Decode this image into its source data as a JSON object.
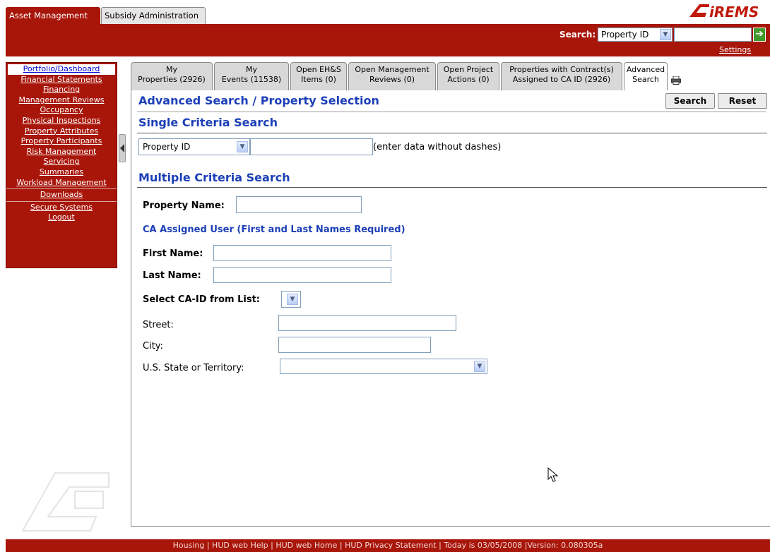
{
  "app_tabs": [
    {
      "label": "Asset Management",
      "active": true
    },
    {
      "label": "Subsidy Administration",
      "active": false
    }
  ],
  "logo": {
    "text": "iREMS"
  },
  "header": {
    "search_label": "Search:",
    "search_type": "Property ID",
    "search_value": "",
    "settings_label": "Settings"
  },
  "nav": {
    "items": [
      "Portfolio/Dashboard",
      "Financial Statements",
      "Financing",
      "Management Reviews",
      "Occupancy",
      "Physical Inspections",
      "Property Attributes",
      "Property Participants",
      "Risk Management",
      "Servicing",
      "Summaries",
      "Workload Management",
      "Downloads",
      "Secure Systems",
      "Logout"
    ]
  },
  "tabs": [
    {
      "line1": "My",
      "line2": "Properties (2926)"
    },
    {
      "line1": "My",
      "line2": "Events (11538)"
    },
    {
      "line1": "Open EH&S",
      "line2": "Items (0)"
    },
    {
      "line1": "Open Management",
      "line2": "Reviews (0)"
    },
    {
      "line1": "Open Project",
      "line2": "Actions (0)"
    },
    {
      "line1": "Properties with Contract(s)",
      "line2": "Assigned to CA ID (2926)"
    },
    {
      "line1": "Advanced",
      "line2": "Search"
    }
  ],
  "main": {
    "title": "Advanced Search / Property Selection",
    "search_button": "Search",
    "reset_button": "Reset",
    "single_title": "Single Criteria Search",
    "single_select": "Property ID",
    "single_value": "",
    "single_hint": "(enter data without dashes)",
    "multi_title": "Multiple Criteria Search",
    "property_name_label": "Property Name:",
    "ca_user_heading": "CA Assigned User (First and Last Names Required)",
    "first_name_label": "First Name:",
    "last_name_label": "Last Name:",
    "ca_id_label": "Select CA-ID from List:",
    "street_label": "Street:",
    "city_label": "City:",
    "state_label": "U.S. State or Territory:",
    "state_value": ""
  },
  "footer": {
    "text": "Housing | HUD web Help | HUD web Home | HUD Privacy Statement | Today is 03/05/2008 |Version: 0.080305a"
  },
  "colors": {
    "brand_red": "#a81509",
    "heading_blue": "#1c3fb7",
    "go_green": "#3f9c2c"
  }
}
